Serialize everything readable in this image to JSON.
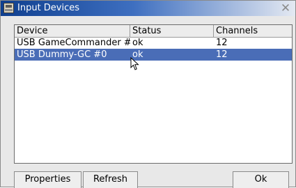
{
  "window": {
    "title": "Input Devices"
  },
  "table": {
    "columns": [
      "Device",
      "Status",
      "Channels"
    ],
    "rows": [
      {
        "device": "USB GameCommander #",
        "status": "ok",
        "channels": "12",
        "selected": false
      },
      {
        "device": "USB Dummy-GC #0",
        "status": "ok",
        "channels": "12",
        "selected": true
      }
    ]
  },
  "buttons": {
    "properties": "Properties",
    "refresh": "Refresh",
    "ok": "Ok"
  },
  "icons": {
    "app": "input-devices-icon",
    "close": "close-icon",
    "pointer": "mouse-cursor-icon"
  },
  "colors": {
    "title_start": "#0f3f8f",
    "selection": "#4a6db7"
  }
}
